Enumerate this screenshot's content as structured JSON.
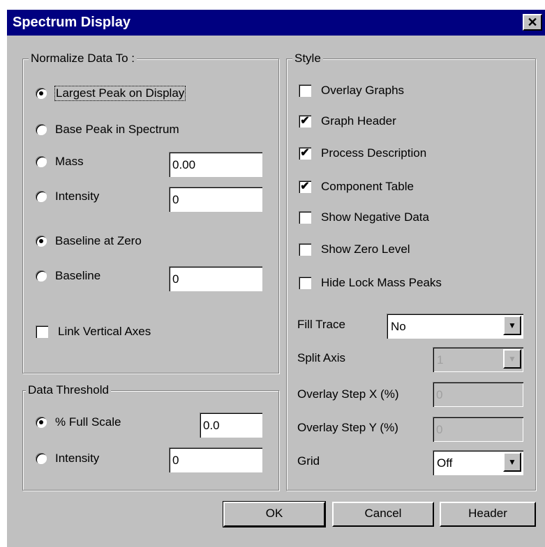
{
  "window": {
    "title": "Spectrum Display",
    "close_glyph": "✕"
  },
  "normalize": {
    "legend": "Normalize Data To :",
    "largest_peak": "Largest Peak on Display",
    "base_peak": "Base Peak in Spectrum",
    "mass_label": "Mass",
    "mass_value": "0.00",
    "intensity_label": "Intensity",
    "intensity_value": "0",
    "baseline_zero": "Baseline at Zero",
    "baseline_label": "Baseline",
    "baseline_value": "0",
    "link_axes": "Link Vertical Axes"
  },
  "threshold": {
    "legend": "Data Threshold",
    "full_scale_label": "% Full Scale",
    "full_scale_value": "0.0",
    "intensity_label": "Intensity",
    "intensity_value": "0"
  },
  "style": {
    "legend": "Style",
    "overlay_graphs": "Overlay Graphs",
    "graph_header": "Graph Header",
    "process_description": "Process Description",
    "component_table": "Component Table",
    "show_negative": "Show Negative Data",
    "show_zero": "Show Zero Level",
    "hide_lock": "Hide Lock Mass Peaks",
    "fill_trace_label": "Fill Trace",
    "fill_trace_value": "No",
    "split_axis_label": "Split Axis",
    "split_axis_value": "1",
    "overlay_x_label": "Overlay Step X (%)",
    "overlay_x_value": "0",
    "overlay_y_label": "Overlay Step Y (%)",
    "overlay_y_value": "0",
    "grid_label": "Grid",
    "grid_value": "Off"
  },
  "buttons": {
    "ok": "OK",
    "cancel": "Cancel",
    "header": "Header"
  },
  "colors": {
    "titlebar": "#000080",
    "face": "#c0c0c0"
  }
}
